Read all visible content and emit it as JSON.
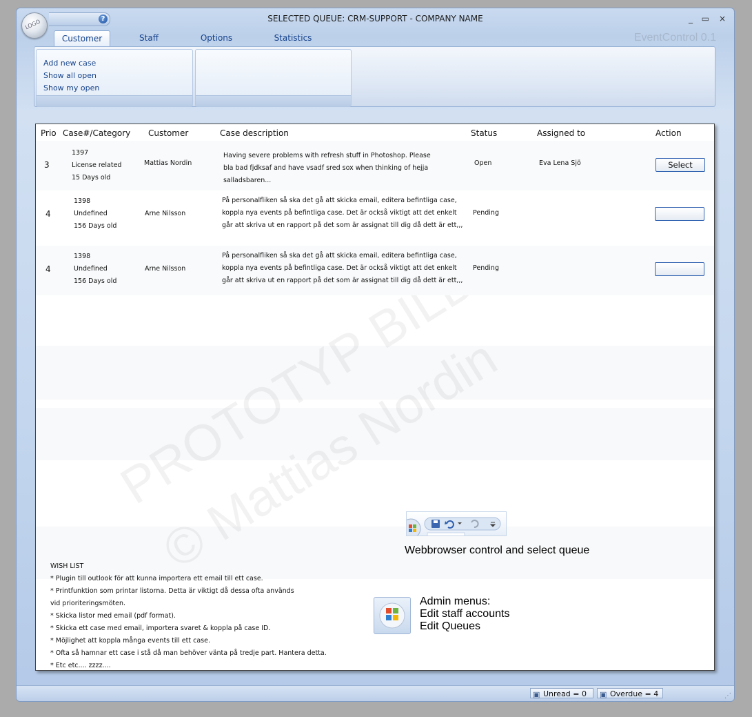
{
  "window": {
    "title": "SELECTED QUEUE:  CRM-SUPPORT - COMPANY NAME",
    "logo_text": "LOGO",
    "brand": "EventControl 0.1",
    "controls": [
      "_",
      "▭",
      "×"
    ]
  },
  "tabs": [
    {
      "label": "Customer",
      "active": true
    },
    {
      "label": "Staff",
      "active": false
    },
    {
      "label": "Options",
      "active": false
    },
    {
      "label": "Statistics",
      "active": false
    }
  ],
  "ribbon": {
    "customer_links": [
      "Add new case",
      "Show all open",
      "Show my open"
    ]
  },
  "table": {
    "headers": [
      "Prio",
      "Case#/Category",
      "Customer",
      "Case description",
      "Status",
      "Assigned to",
      "Action"
    ],
    "rows": [
      {
        "prio": "3",
        "case_no": "1397",
        "category": "License related",
        "age": "15 Days old",
        "customer": "Mattias Nordin",
        "desc": [
          "Having severe problems with refresh stuff in Photoshop. Please",
          "bla bad fjdksaf and have vsadf sred sox when thinking of hejja",
          "salladsbaren..."
        ],
        "status": "Open",
        "assigned": "Eva Lena Sjö",
        "action": "Select"
      },
      {
        "prio": "4",
        "case_no": "1398",
        "category": "Undefined",
        "age": "156 Days old",
        "customer": "Arne Nilsson",
        "desc": [
          "På personalfliken så ska det gå att skicka email, editera befintliga case,",
          "koppla nya events på befintliga case. Det är också viktigt att det enkelt",
          "går att skriva ut en rapport på det som är assignat till dig då dett är ett,,,"
        ],
        "status": "Pending",
        "assigned": "",
        "action": ""
      },
      {
        "prio": "4",
        "case_no": "1398",
        "category": "Undefined",
        "age": "156 Days old",
        "customer": "Arne Nilsson",
        "desc": [
          "På personalfliken så ska det gå att skicka email, editera befintliga case,",
          "koppla nya events på befintliga case. Det är också viktigt att det enkelt",
          "går att skriva ut en rapport på det som är assignat till dig då dett är ett,,,"
        ],
        "status": "Pending",
        "assigned": "",
        "action": ""
      }
    ]
  },
  "watermark": {
    "line1": "PROTOTYP BILD",
    "line2": "© Mattias Nordin"
  },
  "wishlist": {
    "title": "WISH LIST",
    "items": [
      "* Plugin till outlook för att kunna importera ett email till ett case.",
      "* Printfunktion som printar listorna. Detta är viktigt då dessa ofta används",
      "vid prioriteringsmöten.",
      "* Skicka listor med email (pdf format).",
      "* Skicka ett case med email, importera svaret & koppla på case ID.",
      "* Möjlighet att koppla många events till ett case.",
      "* Ofta så hamnar ett case i stå då man behöver vänta på tredje part. Hantera detta.",
      "* Etc etc.... zzzz...."
    ]
  },
  "notes": {
    "webbrowser": "Webbrowser control and select queue",
    "admin_lines": [
      "Admin menus:",
      "Edit staff accounts",
      "Edit Queues"
    ]
  },
  "statusbar": {
    "unread": "Unread = 0",
    "overdue": "Overdue = 4"
  }
}
